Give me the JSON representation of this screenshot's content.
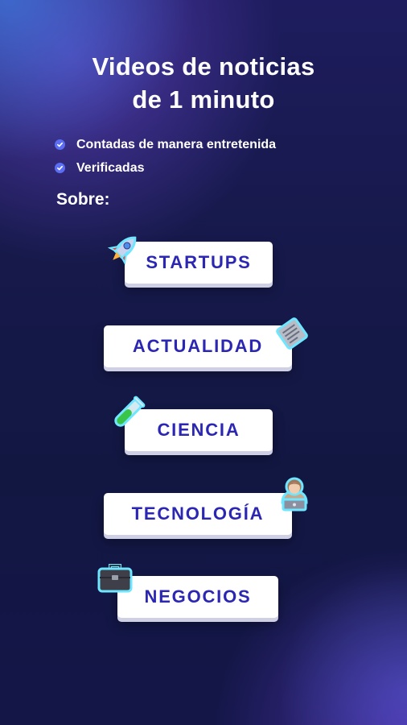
{
  "title": {
    "line1": "Videos de noticias",
    "line2": "de 1 minuto"
  },
  "features": [
    {
      "text": "Contadas de manera entretenida",
      "icon": "check-circle-icon"
    },
    {
      "text": "Verificadas",
      "icon": "check-circle-icon"
    }
  ],
  "topics_label": "Sobre:",
  "topics": [
    {
      "label": "STARTUPS",
      "icon": "rocket-icon"
    },
    {
      "label": "ACTUALIDAD",
      "icon": "newspaper-icon"
    },
    {
      "label": "CIENCIA",
      "icon": "test-tube-icon"
    },
    {
      "label": "TECNOLOGÍA",
      "icon": "person-laptop-icon"
    },
    {
      "label": "NEGOCIOS",
      "icon": "briefcase-icon"
    }
  ],
  "colors": {
    "background": "#16194a",
    "accent": "#2b27b2",
    "check": "#5b6df2",
    "emoji_glow": "#6fe6ff"
  }
}
